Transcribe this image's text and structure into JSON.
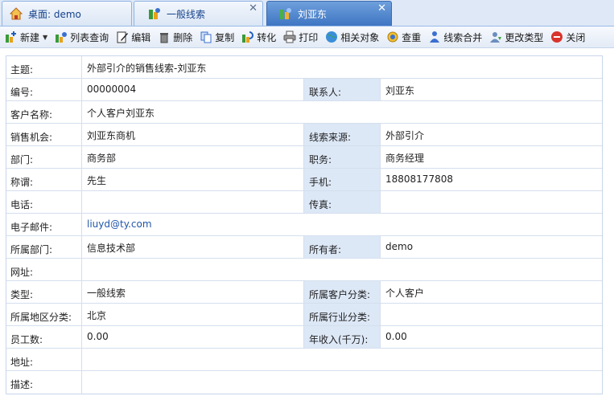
{
  "tabs": [
    {
      "label": "桌面: demo",
      "icon": "home-icon",
      "active": false,
      "closable": false
    },
    {
      "label": "一般线索",
      "icon": "lead-icon",
      "active": false,
      "closable": true
    },
    {
      "label": "刘亚东",
      "icon": "lead-icon",
      "active": true,
      "closable": true
    }
  ],
  "toolbar": {
    "new": "新建",
    "list_query": "列表查询",
    "edit": "编辑",
    "delete": "删除",
    "copy": "复制",
    "convert": "转化",
    "print": "打印",
    "related": "相关对象",
    "dedupe": "查重",
    "merge": "线索合并",
    "change_type": "更改类型",
    "close": "关闭"
  },
  "form": {
    "subject": {
      "label": "主题:",
      "value": "外部引介的销售线索-刘亚东"
    },
    "number": {
      "label": "编号:",
      "value": "00000004"
    },
    "contact": {
      "label": "联系人:",
      "value": "刘亚东"
    },
    "customer_name": {
      "label": "客户名称:",
      "value": "个人客户刘亚东"
    },
    "opportunity": {
      "label": "销售机会:",
      "value": "刘亚东商机"
    },
    "lead_source": {
      "label": "线索来源:",
      "value": "外部引介"
    },
    "department": {
      "label": "部门:",
      "value": "商务部"
    },
    "position": {
      "label": "职务:",
      "value": "商务经理"
    },
    "salutation": {
      "label": "称谓:",
      "value": "先生"
    },
    "mobile": {
      "label": "手机:",
      "value": "18808177808"
    },
    "phone": {
      "label": "电话:",
      "value": ""
    },
    "fax": {
      "label": "传真:",
      "value": ""
    },
    "email": {
      "label": "电子邮件:",
      "value": "liuyd@ty.com"
    },
    "owner_dept": {
      "label": "所属部门:",
      "value": "信息技术部"
    },
    "owner": {
      "label": "所有者:",
      "value": "demo"
    },
    "website": {
      "label": "网址:",
      "value": ""
    },
    "type": {
      "label": "类型:",
      "value": "一般线索"
    },
    "customer_category": {
      "label": "所属客户分类:",
      "value": "个人客户"
    },
    "region": {
      "label": "所属地区分类:",
      "value": "北京"
    },
    "industry": {
      "label": "所属行业分类:",
      "value": ""
    },
    "employees": {
      "label": "员工数:",
      "value": "0.00"
    },
    "revenue": {
      "label": "年收入(千万):",
      "value": "0.00"
    },
    "address": {
      "label": "地址:",
      "value": ""
    },
    "description": {
      "label": "描述:",
      "value": ""
    }
  }
}
